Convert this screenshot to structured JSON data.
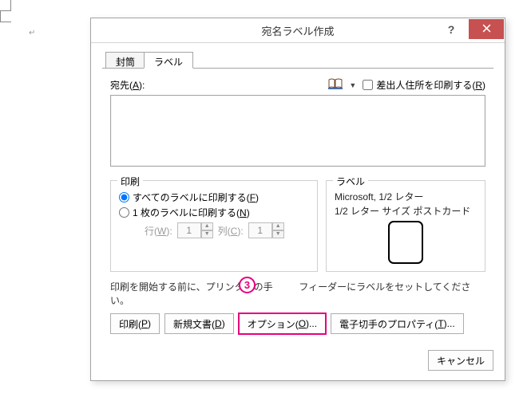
{
  "dialog": {
    "title": "宛名ラベル作成",
    "tabs": [
      {
        "label": "封筒"
      },
      {
        "label": "ラベル"
      }
    ],
    "address": {
      "label_pre": "宛先(",
      "label_key": "A",
      "label_post": "):",
      "textarea_value": "",
      "return_address_label_pre": "差出人住所を印刷する(",
      "return_address_key": "R",
      "return_address_label_post": ")",
      "return_address_checked": false
    },
    "print_group": {
      "title": "印刷",
      "opt_all_pre": "すべてのラベルに印刷する(",
      "opt_all_key": "F",
      "opt_all_post": ")",
      "opt_one_pre": "1 枚のラベルに印刷する(",
      "opt_one_key": "N",
      "opt_one_post": ")",
      "row_label_pre": "行(",
      "row_label_key": "W",
      "row_label_post": "):",
      "row_value": "1",
      "col_label_pre": "列(",
      "col_label_key": "C",
      "col_label_post": "):",
      "col_value": "1",
      "selected": "all"
    },
    "label_group": {
      "title": "ラベル",
      "line1": "Microsoft, 1/2 レター",
      "line2": "1/2 レター サイズ ポストカード"
    },
    "hint_pre": "印刷を開始する前に、プリンターの手",
    "hint_post": "フィーダーにラベルをセットしてください。",
    "annotation": "3",
    "buttons": {
      "print_pre": "印刷(",
      "print_key": "P",
      "print_post": ")",
      "newdoc_pre": "新規文書(",
      "newdoc_key": "D",
      "newdoc_post": ")",
      "options_pre": "オプション(",
      "options_key": "O",
      "options_post": ")...",
      "estamp_pre": "電子切手のプロパティ(",
      "estamp_key": "T",
      "estamp_post": ")...",
      "cancel": "キャンセル"
    }
  }
}
